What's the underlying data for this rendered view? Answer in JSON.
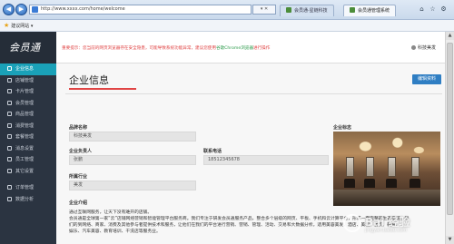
{
  "browser": {
    "back": "◀",
    "forward": "▶",
    "url": "http://www.xxxx.com/home/welcome",
    "tools": "▾ ✕",
    "tabs": [
      {
        "label": "会员通·星链科技"
      },
      {
        "label": "会员通管理系统"
      }
    ],
    "suggest_label": "建议网站 ▾"
  },
  "app": {
    "logo": "会员通",
    "notice_prefix": "重要提示：您当前的网页浏览器存在安全隐患，可能导致系统功能异常，建议您使用",
    "notice_link": "谷歌Chrome浏览器",
    "notice_suffix": "进行操作",
    "user": "科技美发",
    "sidebar": [
      {
        "label": "企业信息",
        "active": true
      },
      {
        "label": "店铺管理",
        "active": false
      },
      {
        "label": "卡片管理",
        "active": false
      },
      {
        "label": "会员管理",
        "active": false
      },
      {
        "label": "商品管理",
        "active": false
      },
      {
        "label": "消费管理",
        "active": false
      },
      {
        "label": "套餐管理",
        "active": false
      },
      {
        "label": "消息设置",
        "active": false
      },
      {
        "label": "员工管理",
        "active": false
      },
      {
        "label": "其它设置",
        "active": false
      },
      {
        "label": "订单管理",
        "active": false
      },
      {
        "label": "数据分析",
        "active": false
      }
    ]
  },
  "page": {
    "title": "企业信息",
    "edit_button": "编辑资料",
    "fields": {
      "brand_label": "品牌名称",
      "brand_value": "科技美发",
      "owner_label": "企业负责人",
      "owner_value": "张鹏",
      "phone_label": "联系电话",
      "phone_value": "18512345678",
      "industry_label": "所属行业",
      "industry_value": "美发",
      "logo_label": "企业标志"
    },
    "intro_label": "企业介绍",
    "intro_lines": [
      "通过互联网服务，让天下没有难开的店铺。",
      "会员通是全球第一家“云”店铺网络营销和智能管理平台服务商。我们专注于研发会员通服务产品，整合多个层级的网页、平板、手机和云计算平台，形成一套完整的生态系统，我",
      "们的到网络、商家、消费及其他参与者提供技术和服务，让他们在我们的平台进行营销、营销、管理、活动、交易和大数据分析。适用美容美发、酒店、美发、餐饮、教育、",
      "娱乐、汽车美容、教育培训、干洗店等服务业。"
    ]
  },
  "watermark": {
    "text": "Bai 经验",
    "sub": "jingyan.baidu.com"
  }
}
